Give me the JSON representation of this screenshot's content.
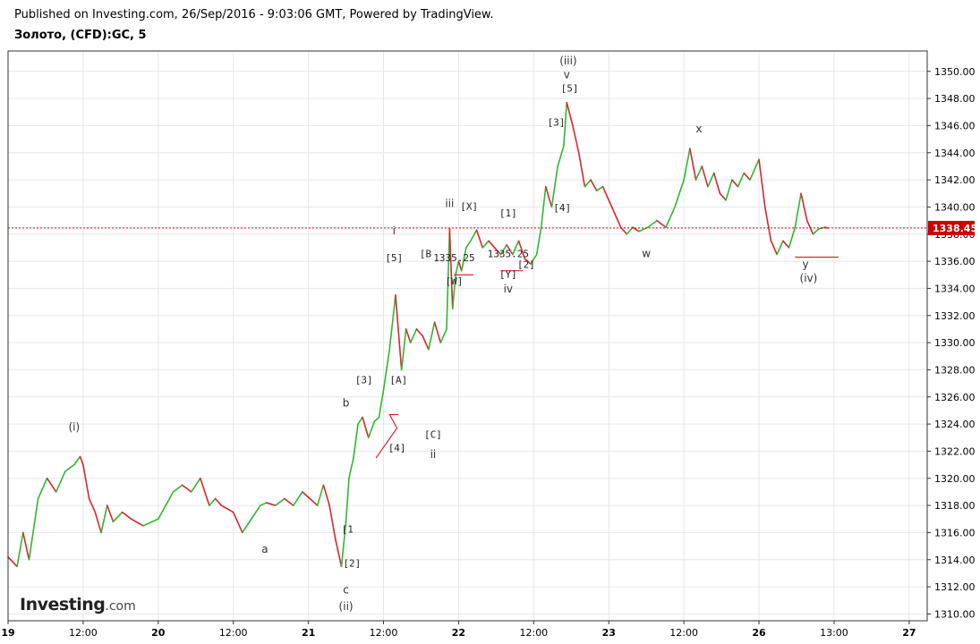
{
  "header": {
    "published": "Published on Investing.com, 26/Sep/2016 - 9:03:06 GMT, Powered by TradingView.",
    "instrument": "Золото, (CFD):GC, 5"
  },
  "colors": {
    "up": "#2eb82e",
    "down": "#d9262e",
    "price_line": "#cc0000",
    "grid": "#e6e6e6",
    "frame": "#333333"
  },
  "logo": {
    "text": "Investing",
    "suffix": ".com"
  },
  "chart_data": {
    "type": "line",
    "ylim": [
      1309.5,
      1351.5
    ],
    "xlim": [
      0,
      6.12
    ],
    "y_ticks": [
      1310,
      1312,
      1314,
      1316,
      1318,
      1320,
      1322,
      1324,
      1326,
      1328,
      1330,
      1332,
      1334,
      1336,
      1338,
      1340,
      1342,
      1344,
      1346,
      1348,
      1350
    ],
    "x_ticks": [
      {
        "x": 0,
        "label": "19"
      },
      {
        "x": 0.5,
        "label": "12:00"
      },
      {
        "x": 1,
        "label": "20"
      },
      {
        "x": 1.5,
        "label": "12:00"
      },
      {
        "x": 2,
        "label": "21"
      },
      {
        "x": 2.5,
        "label": "12:00"
      },
      {
        "x": 3,
        "label": "22"
      },
      {
        "x": 3.5,
        "label": "12:00"
      },
      {
        "x": 4,
        "label": "23"
      },
      {
        "x": 4.5,
        "label": "12:00"
      },
      {
        "x": 5,
        "label": "26"
      },
      {
        "x": 5.5,
        "label": "13:00"
      },
      {
        "x": 6,
        "label": "27"
      }
    ],
    "last_price": 1338.45,
    "last_price_label": "1338.45",
    "series": [
      {
        "x": [
          0,
          0.06,
          0.1,
          0.14,
          0.2,
          0.26,
          0.32,
          0.38,
          0.44,
          0.48,
          0.5,
          0.54,
          0.58,
          0.62,
          0.66,
          0.7,
          0.76,
          0.82,
          0.9,
          0.96,
          1.0,
          1.05,
          1.1,
          1.16,
          1.22,
          1.28,
          1.34,
          1.38,
          1.42,
          1.5,
          1.56,
          1.62,
          1.68,
          1.72,
          1.78,
          1.84,
          1.9,
          1.96,
          2.0,
          2.06,
          2.1,
          2.14,
          2.18,
          2.22,
          2.25,
          2.27,
          2.3,
          2.33,
          2.36,
          2.4,
          2.44,
          2.47,
          2.5,
          2.54,
          2.58,
          2.62,
          2.65,
          2.68,
          2.72,
          2.76,
          2.8,
          2.84,
          2.88,
          2.92,
          2.94,
          2.96,
          2.98,
          3.0,
          3.02,
          3.05,
          3.08,
          3.12,
          3.16,
          3.2,
          3.24,
          3.28,
          3.32,
          3.36,
          3.4,
          3.44,
          3.48,
          3.52,
          3.55,
          3.58,
          3.62,
          3.66,
          3.7,
          3.72,
          3.76,
          3.8,
          3.84,
          3.88,
          3.92,
          3.96,
          4.0,
          4.04,
          4.08,
          4.12,
          4.16,
          4.2,
          4.26,
          4.32,
          4.38,
          4.44,
          4.5,
          4.54,
          4.58,
          4.62,
          4.66,
          4.7,
          4.74,
          4.78,
          4.82,
          4.86,
          4.9,
          4.94,
          5.0,
          5.04,
          5.08,
          5.12,
          5.16,
          5.2,
          5.24,
          5.28,
          5.32,
          5.36,
          5.4,
          5.44,
          5.46
        ],
        "y": [
          1314.2,
          1313.5,
          1316.0,
          1314.0,
          1318.5,
          1320.0,
          1319.0,
          1320.5,
          1321.0,
          1321.6,
          1321.0,
          1318.5,
          1317.5,
          1316.0,
          1318.0,
          1316.8,
          1317.5,
          1317.0,
          1316.5,
          1316.8,
          1317.0,
          1318.0,
          1319.0,
          1319.5,
          1319.0,
          1320.0,
          1318.0,
          1318.5,
          1318.0,
          1317.5,
          1316.0,
          1317.0,
          1318.0,
          1318.2,
          1318.0,
          1318.5,
          1318.0,
          1319.0,
          1318.6,
          1318.0,
          1319.5,
          1318.0,
          1315.5,
          1313.5,
          1316.8,
          1320.0,
          1321.5,
          1324.0,
          1324.5,
          1323.0,
          1324.2,
          1324.5,
          1326.5,
          1329.5,
          1333.5,
          1328.0,
          1331.0,
          1330.0,
          1331.0,
          1330.5,
          1329.5,
          1331.5,
          1330.0,
          1331.0,
          1338.4,
          1332.5,
          1335.0,
          1336.0,
          1335.3,
          1337.0,
          1337.5,
          1338.3,
          1337.0,
          1337.5,
          1337.0,
          1336.5,
          1337.2,
          1336.5,
          1337.5,
          1336.2,
          1335.8,
          1336.5,
          1338.5,
          1341.5,
          1340.0,
          1343.0,
          1344.5,
          1347.7,
          1346.0,
          1344.0,
          1341.5,
          1342.0,
          1341.2,
          1341.5,
          1340.5,
          1339.5,
          1338.5,
          1338.0,
          1338.5,
          1338.2,
          1338.5,
          1339.0,
          1338.5,
          1340.0,
          1342.0,
          1344.3,
          1342.0,
          1343.0,
          1341.5,
          1342.5,
          1341.0,
          1340.5,
          1342.0,
          1341.5,
          1342.5,
          1342.0,
          1343.5,
          1340.0,
          1337.5,
          1336.5,
          1337.5,
          1337.0,
          1338.5,
          1341.0,
          1339.0,
          1338.0,
          1338.4,
          1338.5,
          1338.45
        ]
      }
    ],
    "annotations": [
      {
        "x": 0.44,
        "y": 1323.5,
        "text": "(i)",
        "kind": "wave"
      },
      {
        "x": 1.71,
        "y": 1314.5,
        "text": "a",
        "kind": "wave"
      },
      {
        "x": 2.25,
        "y": 1325.3,
        "text": "b",
        "kind": "wave"
      },
      {
        "x": 2.25,
        "y": 1311.5,
        "text": "c",
        "kind": "wave"
      },
      {
        "x": 2.25,
        "y": 1310.3,
        "text": "(ii)",
        "kind": "wave"
      },
      {
        "x": 2.37,
        "y": 1327.0,
        "text": "[3]",
        "kind": "box"
      },
      {
        "x": 2.26,
        "y": 1316.0,
        "text": "[1",
        "kind": "box"
      },
      {
        "x": 2.29,
        "y": 1313.5,
        "text": "[2]",
        "kind": "box"
      },
      {
        "x": 2.59,
        "y": 1322.0,
        "text": "[4]",
        "kind": "box"
      },
      {
        "x": 2.6,
        "y": 1327.0,
        "text": "[A]",
        "kind": "box"
      },
      {
        "x": 2.57,
        "y": 1336.0,
        "text": "[5]",
        "kind": "box"
      },
      {
        "x": 2.57,
        "y": 1338.0,
        "text": "i",
        "kind": "wave"
      },
      {
        "x": 2.94,
        "y": 1340.0,
        "text": "iii",
        "kind": "wave"
      },
      {
        "x": 2.78,
        "y": 1336.3,
        "text": "[B",
        "kind": "box"
      },
      {
        "x": 2.97,
        "y": 1336.0,
        "text": "1335.25",
        "kind": "box"
      },
      {
        "x": 2.97,
        "y": 1334.3,
        "text": "[W]",
        "kind": "box"
      },
      {
        "x": 3.07,
        "y": 1339.8,
        "text": "[X]",
        "kind": "box"
      },
      {
        "x": 2.83,
        "y": 1323.0,
        "text": "[C]",
        "kind": "box"
      },
      {
        "x": 2.83,
        "y": 1321.5,
        "text": "ii",
        "kind": "wave"
      },
      {
        "x": 3.33,
        "y": 1339.3,
        "text": "[1]",
        "kind": "box"
      },
      {
        "x": 3.33,
        "y": 1336.3,
        "text": "1335.25",
        "kind": "box"
      },
      {
        "x": 3.33,
        "y": 1334.8,
        "text": "[Y]",
        "kind": "box"
      },
      {
        "x": 3.33,
        "y": 1333.7,
        "text": "iv",
        "kind": "wave"
      },
      {
        "x": 3.45,
        "y": 1335.5,
        "text": "[2]",
        "kind": "box"
      },
      {
        "x": 3.65,
        "y": 1346.0,
        "text": "[3]",
        "kind": "box"
      },
      {
        "x": 3.69,
        "y": 1339.7,
        "text": "[4]",
        "kind": "box"
      },
      {
        "x": 3.73,
        "y": 1350.5,
        "text": "(iii)",
        "kind": "wave"
      },
      {
        "x": 3.72,
        "y": 1349.5,
        "text": "v",
        "kind": "wave"
      },
      {
        "x": 3.74,
        "y": 1348.5,
        "text": "[5]",
        "kind": "box"
      },
      {
        "x": 4.25,
        "y": 1336.3,
        "text": "w",
        "kind": "wave"
      },
      {
        "x": 4.6,
        "y": 1345.5,
        "text": "x",
        "kind": "wave"
      },
      {
        "x": 5.31,
        "y": 1335.5,
        "text": "y",
        "kind": "wave"
      },
      {
        "x": 5.33,
        "y": 1334.5,
        "text": "(iv)",
        "kind": "wave"
      }
    ],
    "support_lines": [
      {
        "x1": 2.97,
        "x2": 3.1,
        "y": 1335.0
      },
      {
        "x1": 3.28,
        "x2": 3.43,
        "y": 1335.3
      },
      {
        "x1": 5.24,
        "x2": 5.53,
        "y": 1336.3
      }
    ],
    "triangle": [
      [
        2.45,
        1321.5
      ],
      [
        2.59,
        1323.7
      ],
      [
        2.54,
        1324.7
      ],
      [
        2.6,
        1324.7
      ]
    ]
  }
}
